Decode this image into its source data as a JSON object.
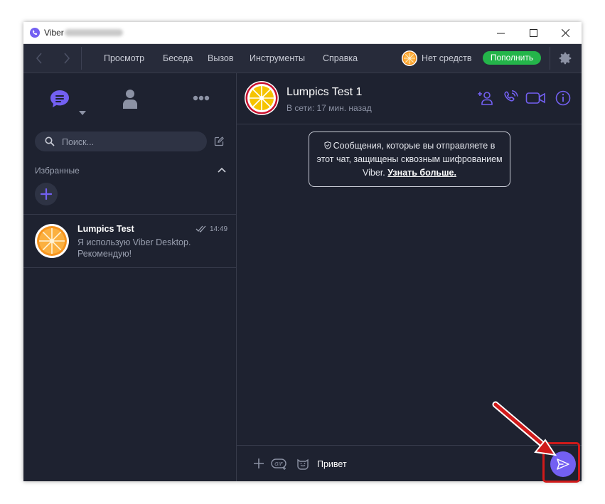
{
  "window": {
    "title": "Viber",
    "minimize_label": "—",
    "maximize_label": "☐",
    "close_label": "✕"
  },
  "menu": {
    "items": [
      "Просмотр",
      "Беседа",
      "Вызов",
      "Инструменты",
      "Справка"
    ],
    "balance_text": "Нет средств",
    "topup_label": "Пополнить"
  },
  "sidebar": {
    "search_placeholder": "Поиск...",
    "favorites_label": "Избранные",
    "chats": [
      {
        "name": "Lumpics Test",
        "time": "14:49",
        "preview": "Я использую Viber Desktop. Рекомендую!"
      }
    ]
  },
  "conversation": {
    "contact_name": "Lumpics Test 1",
    "contact_status": "В сети: 17 мин. назад",
    "e2e_text": "Сообщения, которые вы отправляете в этот чат, защищены сквозным шифрованием Viber.",
    "e2e_link": "Узнать больше.",
    "message_input_value": "Привет"
  },
  "colors": {
    "background": "#1e2230",
    "menubar": "#272b3a",
    "accent_purple": "#7360f2",
    "topup_green": "#24b54a",
    "annotation_red": "#d01a1a",
    "avatar_orange": "#f7941d"
  },
  "icons": {
    "app": "viber-logo-icon",
    "chats_tab": "chat-bubble-icon",
    "contacts_tab": "person-icon",
    "more_tab": "more-dots-icon",
    "search": "search-icon",
    "compose": "compose-icon",
    "add_participant": "add-person-icon",
    "call": "phone-icon",
    "video": "video-camera-icon",
    "info": "info-icon",
    "attach": "plus-icon",
    "gif": "gif-icon",
    "sticker": "sticker-icon",
    "send": "send-arrow-icon",
    "settings": "gear-icon"
  }
}
